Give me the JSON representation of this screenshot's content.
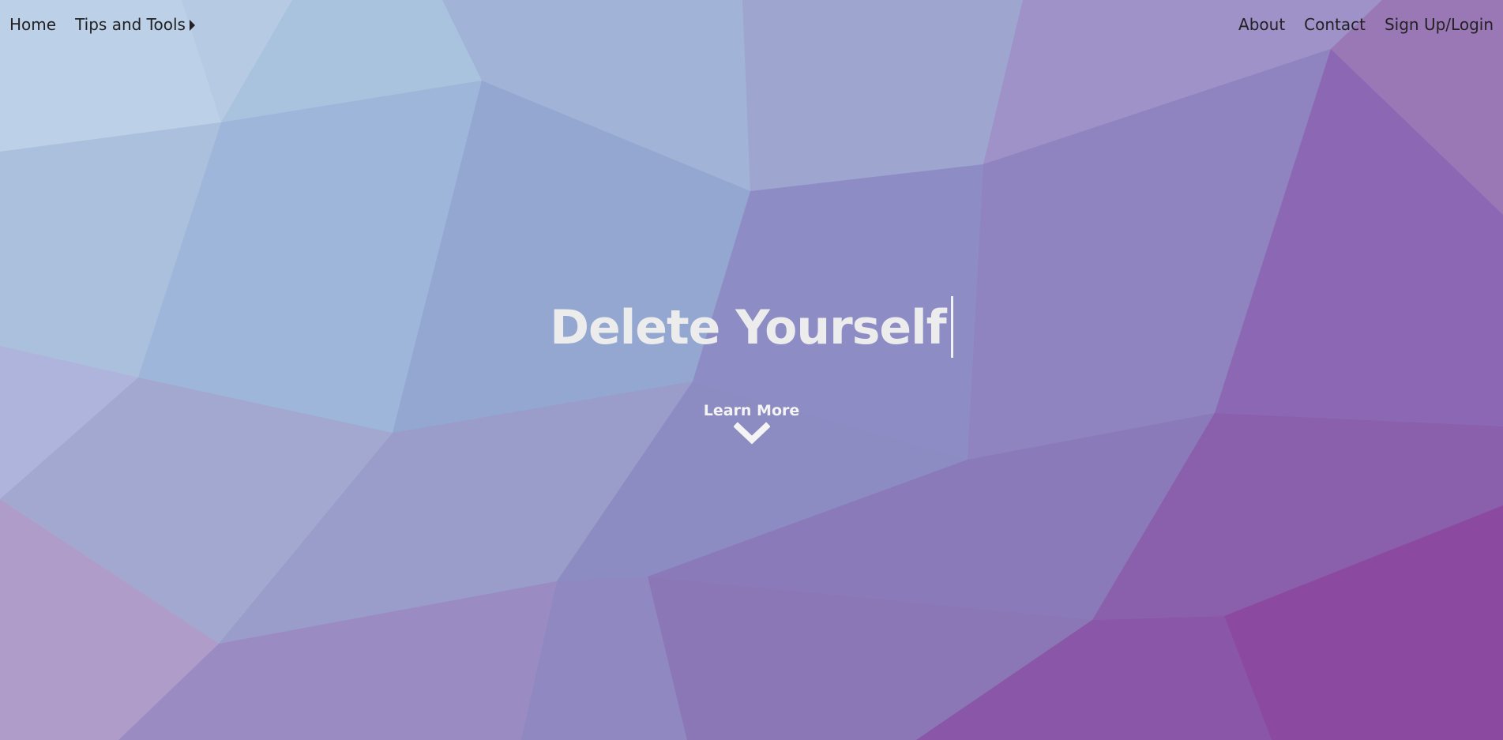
{
  "nav": {
    "home": "Home",
    "tips_tools": "Tips and Tools",
    "about": "About",
    "contact": "Contact",
    "signup": "Sign Up/Login"
  },
  "hero": {
    "title": "Delete Yourself"
  },
  "cta": {
    "label": "Learn More"
  },
  "colors": {
    "text_light": "#ececec",
    "nav_text": "#222222",
    "accent_purple": "#8a55a6"
  },
  "icons": {
    "dropdown": "caret-right-icon",
    "scroll": "chevron-down-icon"
  }
}
